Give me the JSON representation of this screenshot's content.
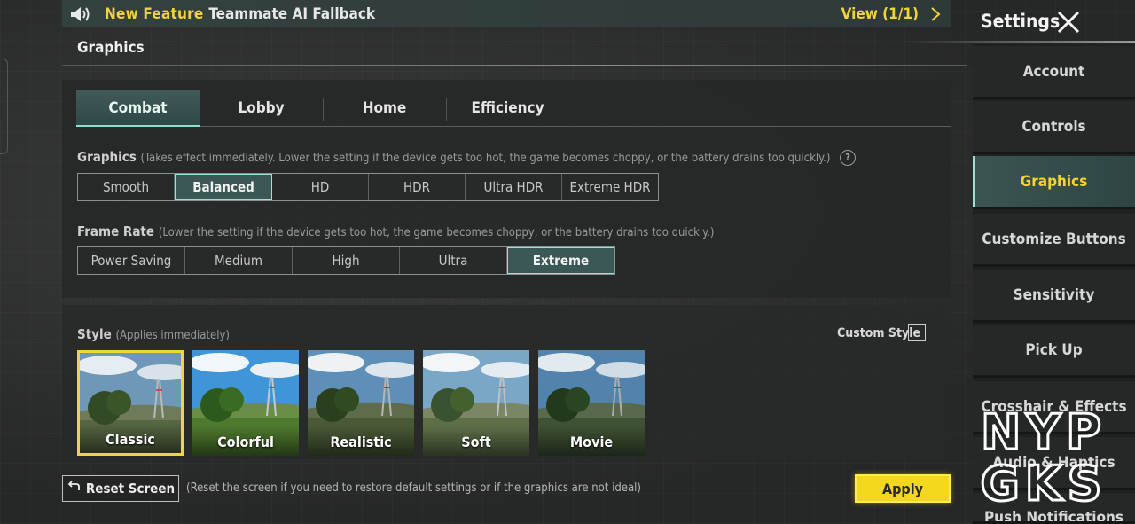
{
  "notice": {
    "icon": "speaker-icon",
    "label_new": "New Feature",
    "text": "Teammate AI Fallback",
    "view": "View (1/1)"
  },
  "header": {
    "title": "Graphics"
  },
  "tabs": [
    {
      "label": "Combat",
      "active": true
    },
    {
      "label": "Lobby",
      "active": false
    },
    {
      "label": "Home",
      "active": false
    },
    {
      "label": "Efficiency",
      "active": false
    }
  ],
  "graphics_setting": {
    "label": "Graphics",
    "note": "(Takes effect immediately. Lower the setting if the device gets too hot, the game becomes choppy, or the battery drains too quickly.)",
    "help": "?",
    "options": [
      "Smooth",
      "Balanced",
      "HD",
      "HDR",
      "Ultra HDR",
      "Extreme HDR"
    ],
    "selected": "Balanced"
  },
  "frame_rate": {
    "label": "Frame Rate",
    "note": "(Lower the setting if the device gets too hot, the game becomes choppy, or the battery drains too quickly.)",
    "options": [
      "Power Saving",
      "Medium",
      "High",
      "Ultra",
      "Extreme"
    ],
    "selected": "Extreme"
  },
  "style": {
    "label": "Style",
    "note": "(Applies immediately)",
    "custom_label": "Custom Style",
    "custom_checked": false,
    "options": [
      "Classic",
      "Colorful",
      "Realistic",
      "Soft",
      "Movie"
    ],
    "selected": "Classic"
  },
  "footer": {
    "reset_label": "Reset Screen",
    "reset_note": "(Reset the screen if you need to restore default settings or if the graphics are not ideal)",
    "apply_label": "Apply"
  },
  "sidebar": {
    "title": "Settings",
    "items": [
      {
        "label": "Account"
      },
      {
        "label": "Controls"
      },
      {
        "label": "Graphics",
        "active": true
      },
      {
        "label": "Customize Buttons"
      },
      {
        "label": "Sensitivity"
      },
      {
        "label": "Pick Up"
      },
      {
        "label": "Crosshair & Effects"
      },
      {
        "label": "Audio & Haptics"
      },
      {
        "label": "Push Notifications"
      }
    ]
  },
  "watermark": {
    "lines": [
      "NYP",
      "GKS"
    ]
  },
  "colors": {
    "accent_yellow": "#f3d81e",
    "accent_teal": "#9ee0d3",
    "panel": "#262727"
  }
}
